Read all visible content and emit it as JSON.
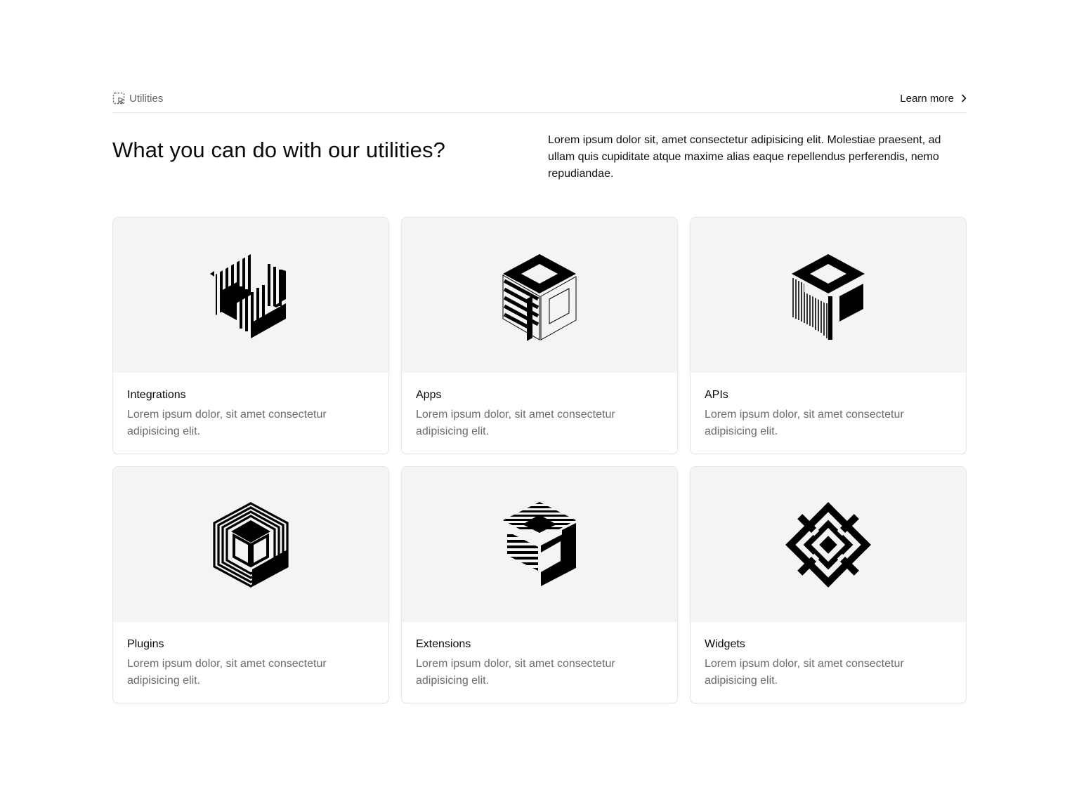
{
  "header": {
    "section_label": "Utilities",
    "section_icon": "dashed-select-cursor-icon",
    "learn_more_label": "Learn more",
    "learn_more_icon": "chevron-right-icon"
  },
  "intro": {
    "headline": "What you can do with our utilities?",
    "description": "Lorem ipsum dolor sit, amet consectetur adipisicing elit. Molestiae praesent, ad ullam quis cupiditate atque maxime alias eaque repellendus perferendis, nemo repudiandae."
  },
  "cards": [
    {
      "title": "Integrations",
      "description": "Lorem ipsum dolor, sit amet consectetur adipisicing elit.",
      "icon": "striped-hexagon-icon"
    },
    {
      "title": "Apps",
      "description": "Lorem ipsum dolor, sit amet consectetur adipisicing elit.",
      "icon": "open-cube-icon"
    },
    {
      "title": "APIs",
      "description": "Lorem ipsum dolor, sit amet consectetur adipisicing elit.",
      "icon": "lined-cube-icon"
    },
    {
      "title": "Plugins",
      "description": "Lorem ipsum dolor, sit amet consectetur adipisicing elit.",
      "icon": "nested-hexagon-icon"
    },
    {
      "title": "Extensions",
      "description": "Lorem ipsum dolor, sit amet consectetur adipisicing elit.",
      "icon": "horizontal-striped-cube-icon"
    },
    {
      "title": "Widgets",
      "description": "Lorem ipsum dolor, sit amet consectetur adipisicing elit.",
      "icon": "diagonal-maze-icon"
    }
  ],
  "colors": {
    "text": "#0a0a0a",
    "muted_text": "#6b6b6b",
    "card_art_bg": "#f4f4f4",
    "border": "#e6e6e6"
  }
}
